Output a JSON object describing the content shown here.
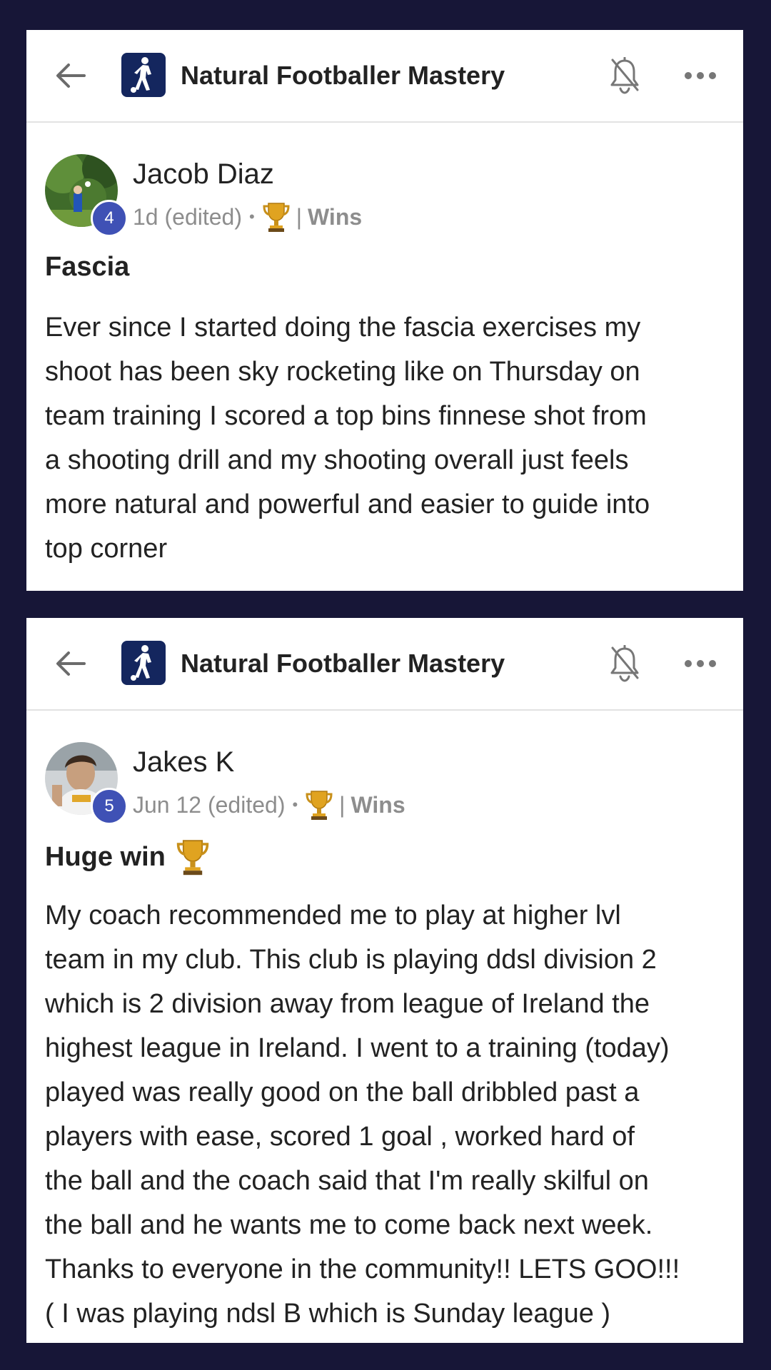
{
  "cards": [
    {
      "header": {
        "group_name": "Natural Footballer Mastery",
        "back_icon": "arrow-left-icon",
        "bell_icon": "bell-off-icon",
        "more_icon": "more-horizontal-icon"
      },
      "post": {
        "author": "Jacob Diaz",
        "level": "4",
        "time": "1d (edited)",
        "category_separator": "|",
        "category": "Wins",
        "title": "Fascia",
        "body_lines": [
          "Ever since I started doing the fascia exercises my",
          "shoot has been sky rocketing like on Thursday on",
          "team training I scored a top bins finnese shot from",
          "a shooting drill and my shooting overall just feels",
          "more natural and powerful and easier to guide into",
          "top corner"
        ]
      }
    },
    {
      "header": {
        "group_name": "Natural Footballer Mastery",
        "back_icon": "arrow-left-icon",
        "bell_icon": "bell-off-icon",
        "more_icon": "more-horizontal-icon"
      },
      "post": {
        "author": "Jakes K",
        "level": "5",
        "time": "Jun 12 (edited)",
        "category_separator": "|",
        "category": "Wins",
        "title": "Huge win",
        "title_emoji": "trophy-icon",
        "body_lines": [
          "My coach recommended me to play at higher lvl",
          "team in my club. This club is playing ddsl division 2",
          "which is 2 division away from league of Ireland the",
          "highest league in Ireland. I went to a training (today)",
          "played was really good on the ball dribbled past a",
          "players with ease, scored 1 goal , worked hard of",
          "the ball and the coach said that I'm really skilful on",
          "the ball and he wants me to come back next week.",
          "Thanks to everyone in the community!! LETS GOO!!!",
          "( I was playing ndsl B which is Sunday league )"
        ]
      }
    }
  ],
  "colors": {
    "page_background": "#171637",
    "card_background": "#ffffff",
    "level_badge": "#3f51b5",
    "logo_background": "#14265e",
    "meta_text": "#8d8d8d"
  }
}
